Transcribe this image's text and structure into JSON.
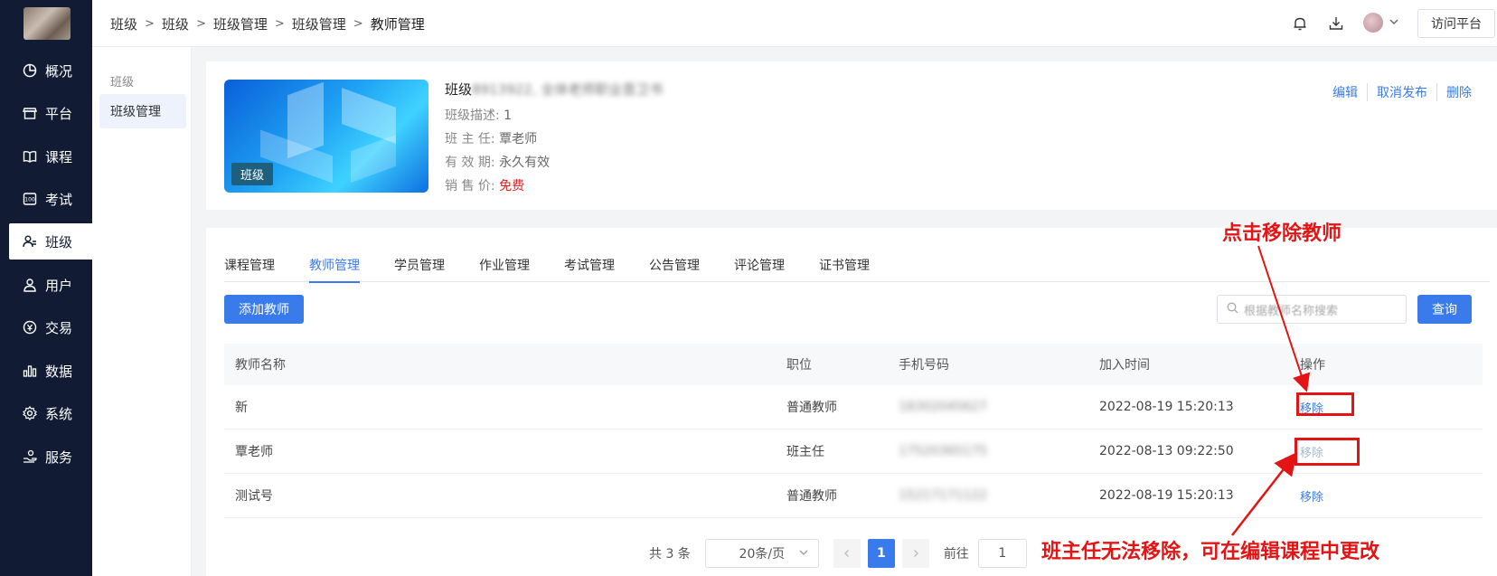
{
  "sidebar": {
    "items": [
      {
        "label": "概况",
        "icon": "pie-chart-icon"
      },
      {
        "label": "平台",
        "icon": "store-icon"
      },
      {
        "label": "课程",
        "icon": "book-icon"
      },
      {
        "label": "考试",
        "icon": "exam-icon"
      },
      {
        "label": "班级",
        "icon": "users-icon"
      },
      {
        "label": "用户",
        "icon": "user-icon"
      },
      {
        "label": "交易",
        "icon": "trade-icon"
      },
      {
        "label": "数据",
        "icon": "bar-chart-icon"
      },
      {
        "label": "系统",
        "icon": "gear-icon"
      },
      {
        "label": "服务",
        "icon": "service-icon"
      }
    ],
    "active": "班级"
  },
  "header": {
    "breadcrumb": [
      "班级",
      "班级",
      "班级管理",
      "班级管理",
      "教师管理"
    ],
    "visit_label": "访问平台"
  },
  "subnav": {
    "group": "班级",
    "item": "班级管理"
  },
  "class_info": {
    "cover_tag": "班级",
    "title_prefix": "班级",
    "title_blurred": "8913922, 全体老师职业晋卫书",
    "desc_label": "班级描述:",
    "desc_value": "1",
    "teacher_label": "班 主 任:",
    "teacher_value": "覃老师",
    "valid_label": "有 效 期:",
    "valid_value": "永久有效",
    "price_label": "销 售 价:",
    "price_value": "免费",
    "actions": [
      "编辑",
      "取消发布",
      "删除"
    ]
  },
  "tabs": [
    "课程管理",
    "教师管理",
    "学员管理",
    "作业管理",
    "考试管理",
    "公告管理",
    "评论管理",
    "证书管理"
  ],
  "active_tab": "教师管理",
  "toolbar": {
    "add_label": "添加教师",
    "search_placeholder": "根据教师名称搜索",
    "query_label": "查询"
  },
  "table": {
    "headers": [
      "教师名称",
      "职位",
      "手机号码",
      "加入时间",
      "操作"
    ],
    "rows": [
      {
        "name": "新",
        "role": "普通教师",
        "phone": "18302045627",
        "joined": "2022-08-19 15:20:13",
        "action": "移除"
      },
      {
        "name": "覃老师",
        "role": "班主任",
        "phone": "17520365175",
        "joined": "2022-08-13 09:22:50",
        "action": "移除"
      },
      {
        "name": "测试号",
        "role": "普通教师",
        "phone": "15217171122",
        "joined": "2022-08-19 15:20:13",
        "action": "移除"
      }
    ]
  },
  "pager": {
    "total": "共 3 条",
    "page_size": "20条/页",
    "current_page": "1",
    "goto_label": "前往",
    "goto_value": "1"
  },
  "annotations": {
    "top_note": "点击移除教师",
    "bottom_note": "班主任无法移除，可在编辑课程中更改",
    "color": "#e41414"
  }
}
